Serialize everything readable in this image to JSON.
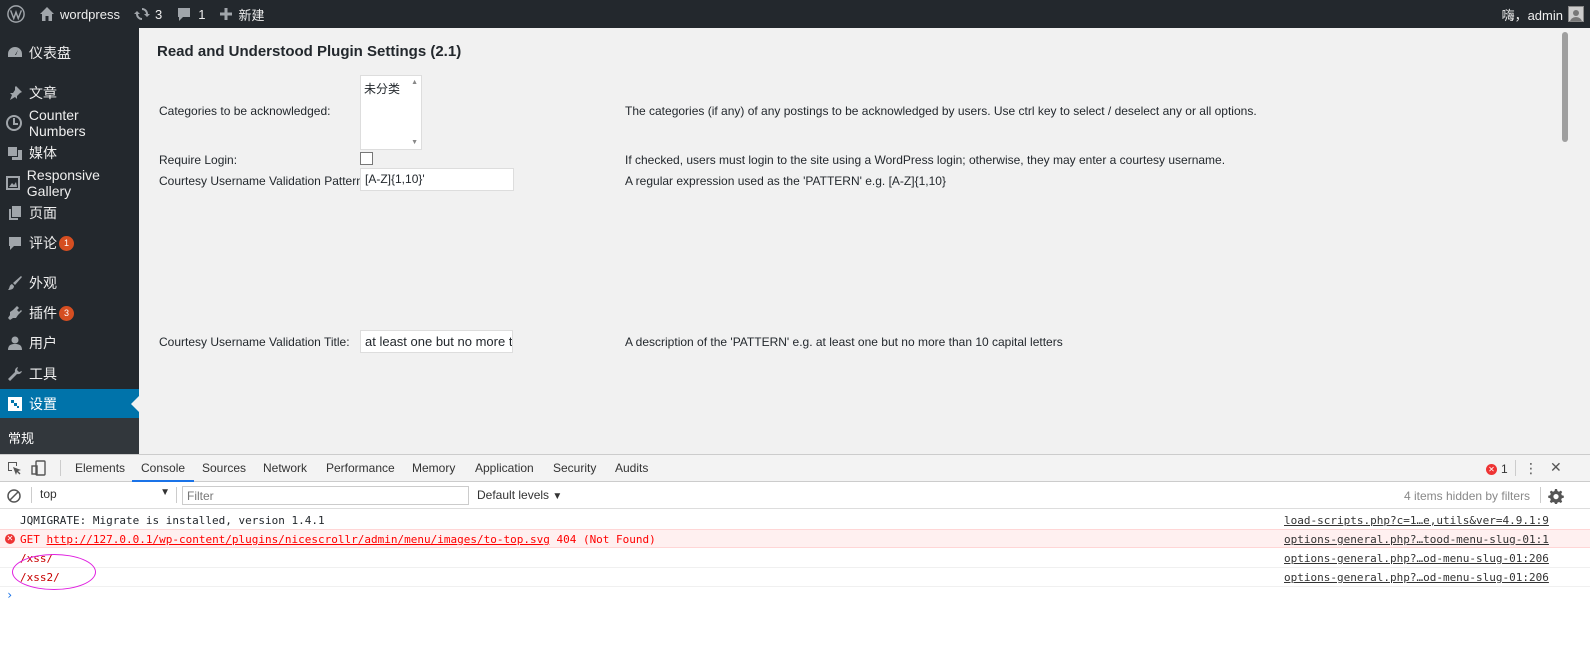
{
  "adminbar": {
    "site_name": "wordpress",
    "updates_count": "3",
    "comments_count": "1",
    "new_label": "新建",
    "greeting": "嗨，admin"
  },
  "sidebar": {
    "items": [
      {
        "label": "仪表盘"
      },
      {
        "label": "文章"
      },
      {
        "label": "Counter Numbers"
      },
      {
        "label": "媒体"
      },
      {
        "label": "Responsive Gallery"
      },
      {
        "label": "页面"
      },
      {
        "label": "评论",
        "badge": "1"
      },
      {
        "label": "外观"
      },
      {
        "label": "插件",
        "badge": "3"
      },
      {
        "label": "用户"
      },
      {
        "label": "工具"
      },
      {
        "label": "设置"
      }
    ],
    "submenu_label": "常规"
  },
  "main": {
    "title": "Read and Understood Plugin Settings (2.1)",
    "categories_label": "Categories to be acknowledged:",
    "categories_option": "未分类",
    "categories_desc": "The categories (if any) of any postings to be acknowledged by users. Use ctrl key to select / deselect any or all options.",
    "require_login_label": "Require Login:",
    "require_login_desc": "If checked, users must login to the site using a WordPress login; otherwise, they may enter a courtesy username.",
    "pattern_label": "Courtesy Username Validation Pattern:",
    "pattern_value": "[A-Z]{1,10}'",
    "pattern_desc": "A regular expression used as the 'PATTERN' e.g. [A-Z]{1,10}",
    "title_label": "Courtesy Username Validation Title:",
    "title_value": "at least one but no more t",
    "title_desc": "A description of the 'PATTERN' e.g. at least one but no more than 10 capital letters"
  },
  "devtools": {
    "tabs": [
      "Elements",
      "Console",
      "Sources",
      "Network",
      "Performance",
      "Memory",
      "Application",
      "Security",
      "Audits"
    ],
    "active_tab": "Console",
    "error_count": "1",
    "context": "top",
    "filter_placeholder": "Filter",
    "levels": "Default levels",
    "hidden_info": "4 items hidden by filters",
    "logs": [
      {
        "msg": "JQMIGRATE: Migrate is installed, version 1.4.1",
        "src": "load-scripts.php?c=1…e,utils&ver=4.9.1:9"
      },
      {
        "msg_prefix": "GET ",
        "msg_url": "http://127.0.0.1/wp-content/plugins/nicescrollr/admin/menu/images/to-top.svg",
        "msg_suffix": " 404 (Not Found)",
        "src": "options-general.php?…tood-menu-slug-01:1"
      },
      {
        "msg": "/xss/",
        "src": "options-general.php?…od-menu-slug-01:206"
      },
      {
        "msg": "/xss2/",
        "src": "options-general.php?…od-menu-slug-01:206"
      }
    ],
    "prompt": "›"
  },
  "colors": {
    "adminbar_bg": "#23282d",
    "sidebar_active": "#0073aa",
    "badge": "#d54e21",
    "error_red": "#ff0000",
    "annotation_magenta": "#e020e0"
  }
}
